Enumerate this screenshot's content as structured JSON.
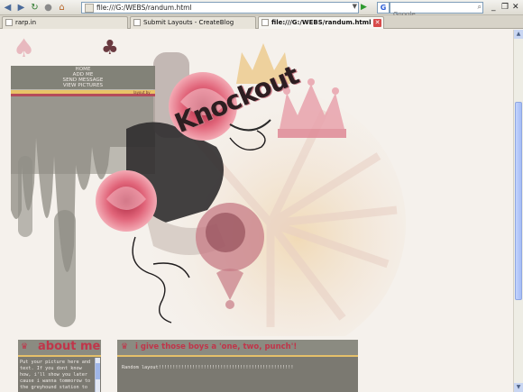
{
  "browser": {
    "url": "file:///G:/WEBS/randum.html",
    "search_placeholder": "Google",
    "search_engine_letter": "G",
    "tabs": [
      {
        "label": "rarp.in",
        "active": false
      },
      {
        "label": "Submit Layouts - CreateBlog",
        "active": false
      },
      {
        "label": "file:///G:/WEBS/randum.html",
        "active": true
      }
    ],
    "icons": {
      "back": "back-arrow-icon",
      "forward": "forward-arrow-icon",
      "reload": "reload-icon",
      "stop": "stop-icon",
      "home": "home-icon",
      "go": "go-arrow-icon",
      "search_go": "search-magnifier-icon"
    },
    "window_controls": {
      "minimize": "_",
      "restore": "❐",
      "close": "✕"
    }
  },
  "page": {
    "nav_links": [
      "HOME",
      "ADD ME",
      "SEND MESSAGE",
      "VIEW PICTURES"
    ],
    "header_title": "Knockout",
    "credit": "layout by",
    "colors": {
      "accent_red": "#c0354a",
      "accent_gold": "#e5c06a",
      "box_grey": "#7b7971",
      "background": "#f5f1ec"
    },
    "about_box": {
      "title": "about me",
      "body": "Put your picture here and text. If you dont know how, i'll show you later cause i wanna tommorow to the greyhound station to"
    },
    "main_box": {
      "title": "i give those boys a 'one, two, punch'!",
      "body": "Random layout!!!!!!!!!!!!!!!!!!!!!!!!!!!!!!!!!!!!!!!!!!!!!!!!"
    }
  }
}
